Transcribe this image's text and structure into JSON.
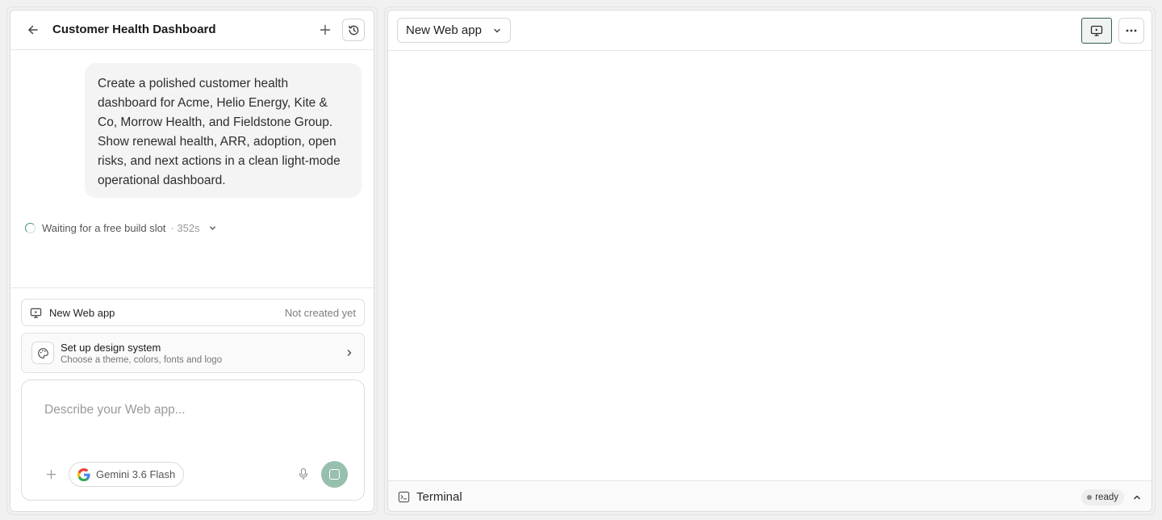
{
  "chat": {
    "title": "Customer Health Dashboard",
    "user_message": "Create a polished customer health dashboard for Acme, Helio Energy, Kite & Co, Morrow Health, and Fieldstone Group. Show renewal health, ARR, adoption, open risks, and next actions in a clean light-mode operational dashboard.",
    "status_text": "Waiting for a free build slot",
    "status_time": "· 352s"
  },
  "app_row": {
    "label": "New Web app",
    "state": "Not created yet"
  },
  "design_system": {
    "title": "Set up design system",
    "subtitle": "Choose a theme, colors, fonts and logo"
  },
  "composer": {
    "placeholder": "Describe your Web app...",
    "model": "Gemini 3.6 Flash"
  },
  "preview": {
    "app_select": "New Web app"
  },
  "terminal": {
    "label": "Terminal",
    "status": "ready"
  },
  "colors": {
    "accent": "#97bfae",
    "spinner": "#3f8f73",
    "preview_border": "#2f5f52"
  },
  "icons": [
    "arrow-left-icon",
    "plus-icon",
    "history-icon",
    "chevron-down-icon",
    "monitor-icon",
    "palette-icon",
    "chevron-right-icon",
    "google-icon",
    "microphone-icon",
    "stop-icon",
    "ellipsis-icon",
    "terminal-icon",
    "chevron-up-icon"
  ]
}
